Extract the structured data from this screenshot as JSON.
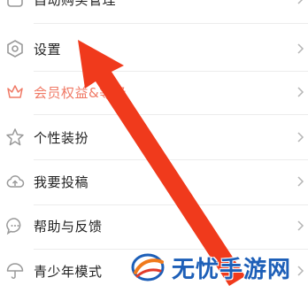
{
  "menu": {
    "items": [
      {
        "label": "自动购买管理",
        "icon": "auto-buy-icon",
        "accent": false
      },
      {
        "label": "设置",
        "icon": "settings-hexagon-icon",
        "accent": false
      },
      {
        "label": "会员权益&等级",
        "icon": "crown-icon",
        "accent": true
      },
      {
        "label": "个性装扮",
        "icon": "star-badge-icon",
        "accent": false
      },
      {
        "label": "我要投稿",
        "icon": "cloud-upload-icon",
        "accent": false
      },
      {
        "label": "帮助与反馈",
        "icon": "chat-bubble-icon",
        "accent": false
      },
      {
        "label": "青少年模式",
        "icon": "umbrella-icon",
        "accent": false
      }
    ]
  },
  "colors": {
    "accent_label": "#f07a66",
    "arrow": "#f03a1c",
    "watermark_text": "#1d5fb8"
  },
  "watermark": {
    "text": "无忧手游网"
  }
}
